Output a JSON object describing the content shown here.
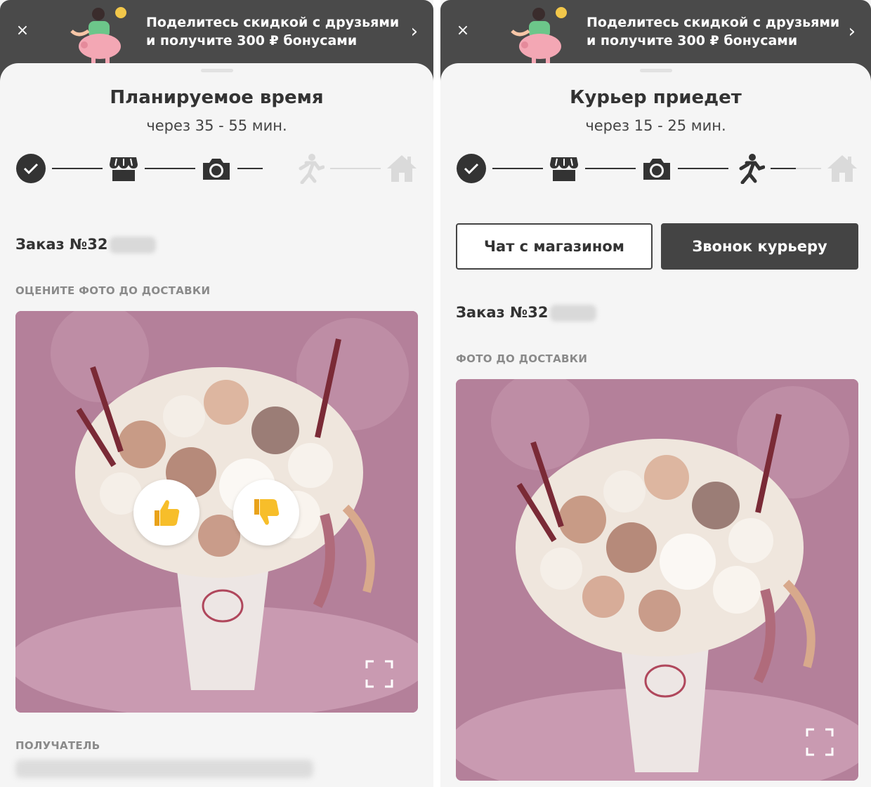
{
  "left": {
    "promo": {
      "close": "×",
      "text": "Поделитесь скидкой с друзьями и получите 300 ₽ бонусами",
      "arrow": "›"
    },
    "title": "Планируемое время",
    "subtitle": "через 35 - 55 мин.",
    "steps": [
      {
        "icon": "check-icon",
        "state": "done"
      },
      {
        "icon": "store-icon",
        "state": "done"
      },
      {
        "icon": "camera-icon",
        "state": "active"
      },
      {
        "icon": "courier-icon",
        "state": "pending"
      },
      {
        "icon": "home-icon",
        "state": "pending"
      }
    ],
    "order_label": "Заказ №32",
    "photo_section": "ОЦЕНИТЕ ФОТО ДО ДОСТАВКИ",
    "rating": {
      "like": "👍",
      "dislike": "👎"
    },
    "recipient_section": "ПОЛУЧАТЕЛЬ"
  },
  "right": {
    "promo": {
      "close": "×",
      "text": "Поделитесь скидкой с друзьями и получите 300 ₽ бонусами",
      "arrow": "›"
    },
    "title": "Курьер приедет",
    "subtitle": "через 15 - 25 мин.",
    "steps": [
      {
        "icon": "check-icon",
        "state": "done"
      },
      {
        "icon": "store-icon",
        "state": "done"
      },
      {
        "icon": "camera-icon",
        "state": "done"
      },
      {
        "icon": "courier-icon",
        "state": "active"
      },
      {
        "icon": "home-icon",
        "state": "pending"
      }
    ],
    "buttons": {
      "chat": "Чат с магазином",
      "call": "Звонок курьеру"
    },
    "order_label": "Заказ №32",
    "photo_section": "ФОТО ДО ДОСТАВКИ"
  },
  "colors": {
    "dark": "#444444",
    "promo_bg": "#4a4a4a",
    "pending": "#dadada",
    "photo_bg": "#b87f9c"
  }
}
